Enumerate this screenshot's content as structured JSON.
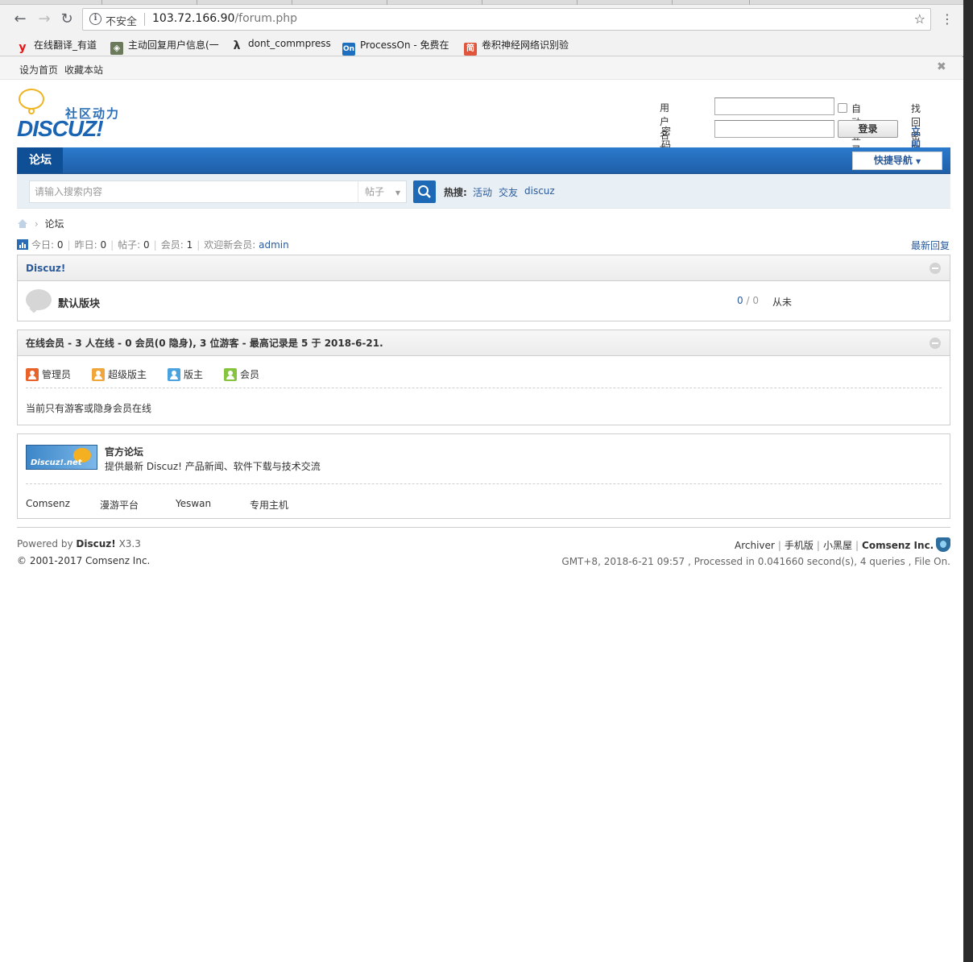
{
  "browser": {
    "security_label": "不安全",
    "url_host": "103.72.166.90",
    "url_path": "/forum.php",
    "bookmarks": [
      {
        "label": "在线翻译_有道",
        "icon": "youdao-icon"
      },
      {
        "label": "主动回复用户信息(一",
        "icon": "dragon-icon"
      },
      {
        "label": "dont_commpress",
        "icon": "lambda-icon"
      },
      {
        "label": "ProcessOn - 免费在",
        "icon": "processon-icon"
      },
      {
        "label": "卷积神经网络识别验",
        "icon": "jian-icon"
      }
    ]
  },
  "topbar": {
    "set_home": "设为首页",
    "bookmark_site": "收藏本站"
  },
  "logo": {
    "slogan": "社区动力",
    "word": "DISCUZ!"
  },
  "login": {
    "username_label": "用户名",
    "password_label": "密码",
    "auto_login": "自动登录",
    "login_button": "登录",
    "find_password": "找回密码",
    "register": "立即注册"
  },
  "nav": {
    "forum_tab": "论坛",
    "quick_nav": "快捷导航"
  },
  "search": {
    "placeholder": "请输入搜索内容",
    "type": "帖子",
    "hot_label": "热搜:",
    "hot_terms": [
      "活动",
      "交友",
      "discuz"
    ]
  },
  "breadcrumb": {
    "current": "论坛"
  },
  "stats": {
    "today_label": "今日:",
    "today": "0",
    "yesterday_label": "昨日:",
    "yesterday": "0",
    "posts_label": "帖子:",
    "posts": "0",
    "members_label": "会员:",
    "members": "1",
    "welcome_label": "欢迎新会员:",
    "newest_member": "admin",
    "latest_reply": "最新回复"
  },
  "category": {
    "title": "Discuz!",
    "forums": [
      {
        "name": "默认版块",
        "threads": "0",
        "posts": "0",
        "last": "从未"
      }
    ]
  },
  "online": {
    "title": "在线会员 - 3 人在线 - 0 会员(0 隐身), 3 位游客 - 最高记录是 5 于 2018-6-21.",
    "legend": [
      {
        "label": "管理员",
        "color": "#e8622a"
      },
      {
        "label": "超级版主",
        "color": "#f0a63a"
      },
      {
        "label": "版主",
        "color": "#4aa3df"
      },
      {
        "label": "会员",
        "color": "#86c440"
      }
    ],
    "note": "当前只有游客或隐身会员在线"
  },
  "links": {
    "banner_text": "Discuz!.net",
    "official_title": "官方论坛",
    "official_desc": "提供最新 Discuz! 产品新闻、软件下载与技术交流",
    "partners": [
      "Comsenz",
      "漫游平台",
      "Yeswan",
      "专用主机"
    ]
  },
  "footer": {
    "powered_prefix": "Powered by",
    "powered_name": "Discuz!",
    "version": "X3.3",
    "copyright": "© 2001-2017 Comsenz Inc.",
    "links": [
      "Archiver",
      "手机版",
      "小黑屋"
    ],
    "company": "Comsenz Inc.",
    "debug": "GMT+8, 2018-6-21 09:57 , Processed in 0.041660 second(s), 4 queries , File On."
  }
}
